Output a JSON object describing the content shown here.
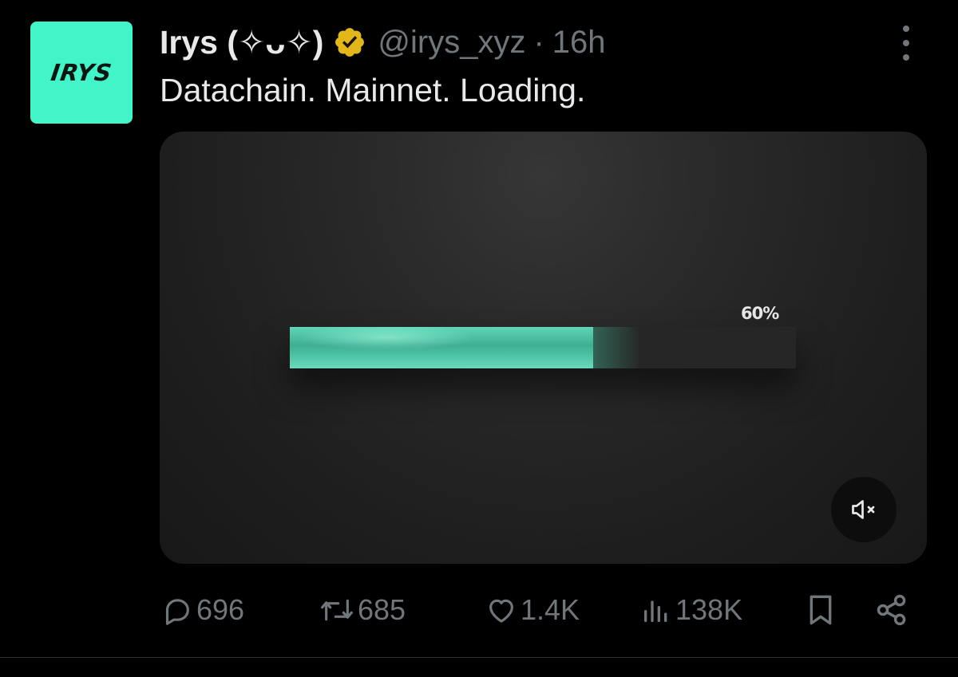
{
  "avatar": {
    "text": "IRYS",
    "color": "#41f5c8"
  },
  "author": {
    "display_name": "Irys (✧ᴗ✧)",
    "verified_icon": "gold-verified-badge-icon",
    "handle": "@irys_xyz",
    "separator": "·",
    "time_ago": "16h"
  },
  "more_icon": "more-options-icon",
  "tweet": {
    "text": "Datachain. Mainnet. Loading."
  },
  "media": {
    "progress_label": "60%",
    "progress_value": 0.6,
    "accent_color": "#4dc5a5",
    "mute_icon": "speaker-muted-icon"
  },
  "actions": {
    "replies": {
      "icon": "reply-bubble-icon",
      "count": "696"
    },
    "reposts": {
      "icon": "repost-icon",
      "count": "685"
    },
    "likes": {
      "icon": "heart-icon",
      "count": "1.4K"
    },
    "views": {
      "icon": "views-chart-icon",
      "count": "138K"
    },
    "bookmark": {
      "icon": "bookmark-icon"
    },
    "share": {
      "icon": "share-icon"
    }
  },
  "colors": {
    "background": "#000000",
    "text_primary": "#e7e9ea",
    "text_secondary": "#71767b",
    "verified_gold": "#e2b719"
  }
}
